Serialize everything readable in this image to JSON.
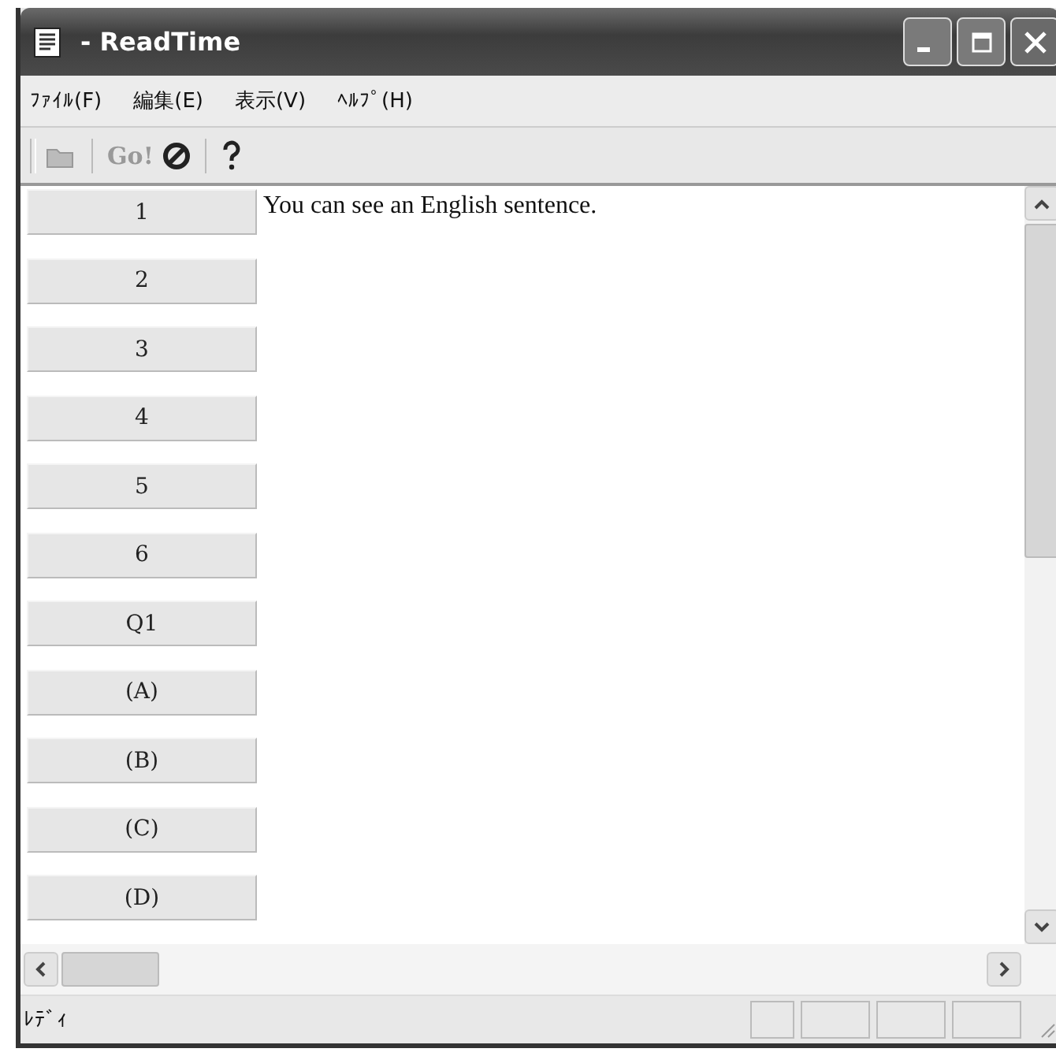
{
  "window": {
    "title": "- ReadTime"
  },
  "menu": [
    "ﾌｧｲﾙ(F)",
    "編集(E)",
    "表示(V)",
    "ﾍﾙﾌﾟ(H)"
  ],
  "toolbar": [
    {
      "kind": "open",
      "disabled": true
    },
    {
      "kind": "go",
      "label": "Go!",
      "disabled": true
    },
    {
      "kind": "stop",
      "disabled": false
    },
    {
      "kind": "help",
      "disabled": false
    }
  ],
  "rows": [
    {
      "header": "1",
      "text": "You can see an English sentence."
    },
    {
      "header": "2"
    },
    {
      "header": "3"
    },
    {
      "header": "4"
    },
    {
      "header": "5"
    },
    {
      "header": "6"
    },
    {
      "header": "Q1"
    },
    {
      "header": "(A)"
    },
    {
      "header": "(B)"
    },
    {
      "header": "(C)"
    },
    {
      "header": "(D)"
    }
  ],
  "status_bar": {
    "text": "ﾚﾃﾞｨ"
  }
}
